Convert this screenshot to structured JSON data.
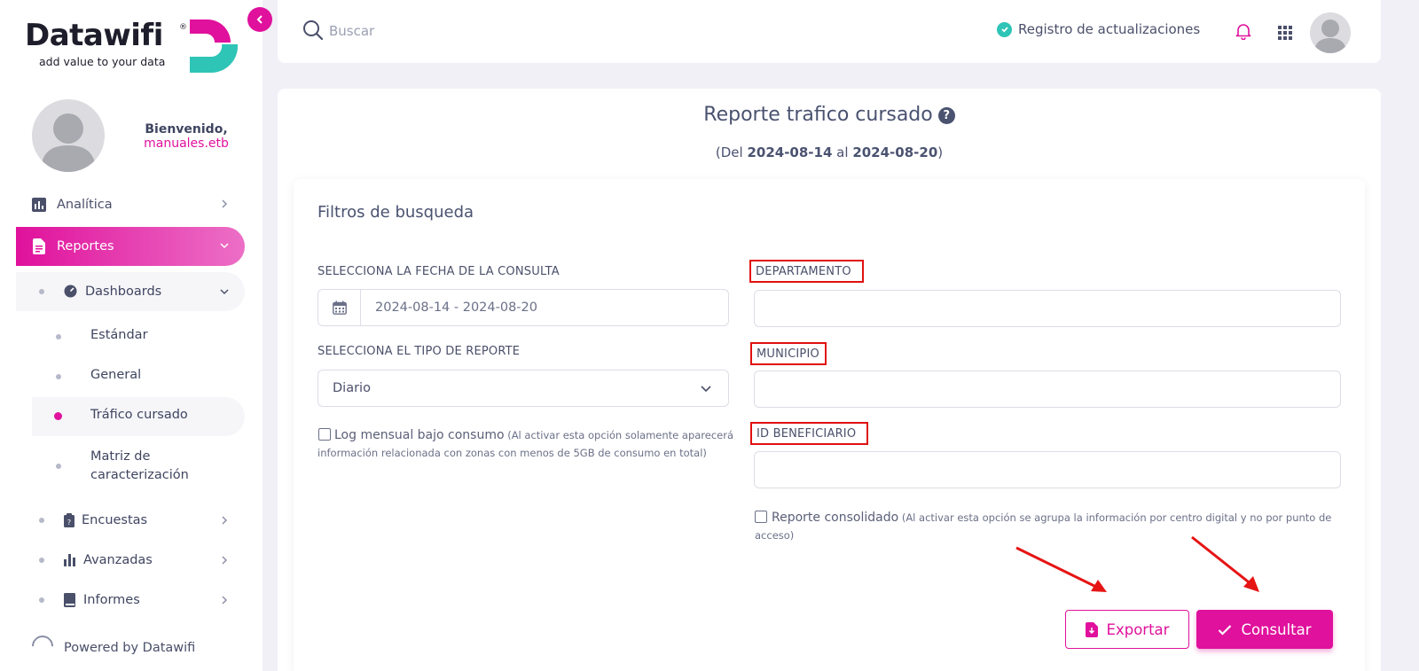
{
  "brand": {
    "name": "Datawifi",
    "registered": "®",
    "tagline": "add value to your data",
    "colors": {
      "primary": "#e0119c",
      "teal": "#2ec4b6",
      "text": "#4a4f6a"
    }
  },
  "user": {
    "greeting": "Bienvenido,",
    "username": "manuales.etb"
  },
  "sidebar": {
    "items": [
      {
        "label": "Analítica",
        "icon": "chart-icon"
      },
      {
        "label": "Reportes",
        "icon": "document-icon"
      },
      {
        "label": "Dashboards",
        "icon": "dashboard-icon"
      },
      {
        "label": "Estándar"
      },
      {
        "label": "General"
      },
      {
        "label": "Tráfico cursado"
      },
      {
        "label": "Matriz de caracterización"
      },
      {
        "label": "Encuestas",
        "icon": "clipboard-icon"
      },
      {
        "label": "Avanzadas",
        "icon": "bar-chart-icon"
      },
      {
        "label": "Informes",
        "icon": "book-icon"
      }
    ],
    "footer": "Powered by Datawifi"
  },
  "topbar": {
    "search_placeholder": "Buscar",
    "updates_label": "Registro de actualizaciones"
  },
  "page": {
    "title": "Reporte trafico cursado",
    "range_prefix": "(Del ",
    "range_from": "2024-08-14",
    "range_mid": " al ",
    "range_to": "2024-08-20",
    "range_suffix": ")"
  },
  "filters": {
    "title": "Filtros de busqueda",
    "date_label": "SELECCIONA LA FECHA DE LA CONSULTA",
    "date_value": "2024-08-14 - 2024-08-20",
    "type_label": "SELECCIONA EL TIPO DE REPORTE",
    "type_value": "Diario",
    "departamento_label": "DEPARTAMENTO",
    "municipio_label": "MUNICIPIO",
    "beneficiario_label": "ID BENEFICIARIO",
    "log_label": "Log mensual bajo consumo",
    "log_note": " (Al activar esta opción solamente aparecerá información relacionada con zonas con menos de 5GB de consumo en total)",
    "consolidado_label": "Reporte consolidado",
    "consolidado_note": " (Al activar esta opción se agrupa la información por centro digital y no por punto de acceso)"
  },
  "actions": {
    "export_label": "Exportar",
    "consult_label": "Consultar"
  }
}
